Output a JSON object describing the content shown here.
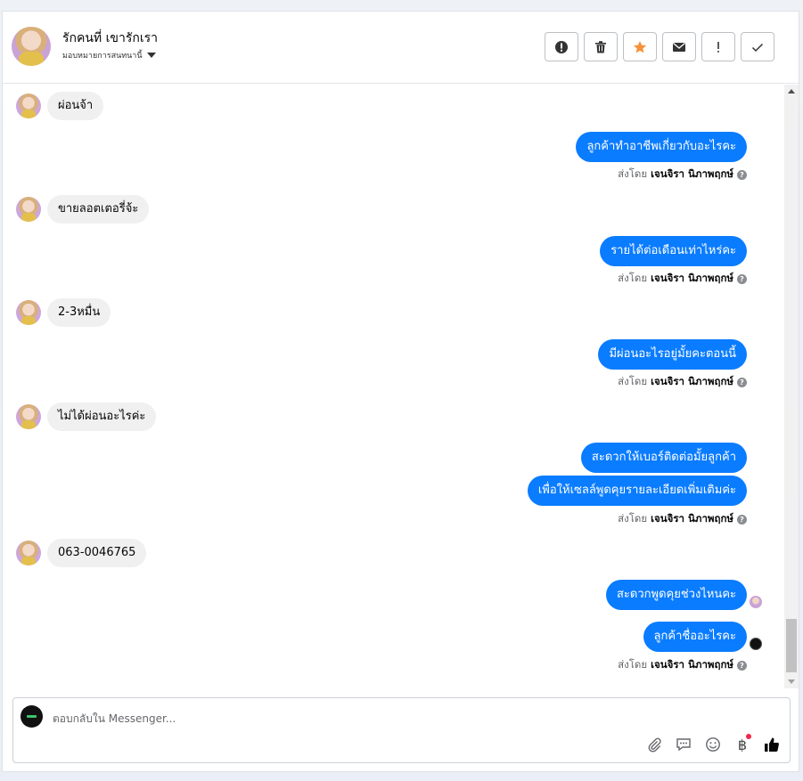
{
  "header": {
    "name": "รักคนที่ เขารักเรา",
    "assign_label": "มอบหมายการสนทนานี้",
    "actions": [
      {
        "icon": "alert-icon"
      },
      {
        "icon": "trash-icon"
      },
      {
        "icon": "star-icon",
        "color": "#f7923a"
      },
      {
        "icon": "mail-icon"
      },
      {
        "icon": "exclamation-icon"
      },
      {
        "icon": "check-icon"
      }
    ]
  },
  "messages": {
    "m1": "ผ่อนจ้า",
    "m2": "ลูกค้าทำอาชีพเกี่ยวกับอะไรคะ",
    "m3": "ขายลอตเตอรี่จ้ะ",
    "m4": "รายได้ต่อเดือนเท่าไหร่คะ",
    "m5": "2-3หมื่น",
    "m6": "มีผ่อนอะไรอยู่มั้ยคะตอนนี้",
    "m7": "ไม่ได้ผ่อนอะไรค่ะ",
    "m8": "สะดวกให้เบอร์ติดต่อมั้ยลูกค้า",
    "m9": "เพื่อให้เซลล์พูดคุยรายละเอียดเพิ่มเติมค่ะ",
    "m10": "063-0046765",
    "m11": "สะดวกพูดคุยช่วงไหนคะ",
    "m12": "ลูกค้าชื่ออะไรคะ"
  },
  "sent_by": {
    "prefix": "ส่งโดย",
    "name": "เจนจิรา นิภาพฤกษ์",
    "help": "?"
  },
  "composer": {
    "placeholder": "ตอบกลับใน Messenger...",
    "currency": "฿"
  },
  "colors": {
    "outgoing": "#0a7cff",
    "incoming": "#f0f0f0",
    "star": "#f7923a",
    "notify_dot": "#f02849"
  }
}
